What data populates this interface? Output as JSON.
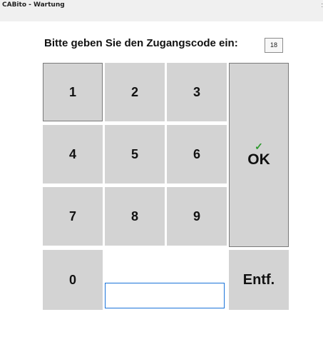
{
  "window": {
    "title": "CABito - Wartung",
    "corner_mark": ":"
  },
  "prompt": {
    "text": "Bitte geben Sie den Zugangscode ein:"
  },
  "digit_count": "18",
  "keypad": {
    "digits": [
      "1",
      "2",
      "3",
      "4",
      "5",
      "6",
      "7",
      "8",
      "9",
      "0"
    ],
    "ok_label": "OK",
    "ok_icon": "check-icon",
    "delete_label": "Entf."
  },
  "code_input": {
    "value": ""
  },
  "colors": {
    "key_bg": "#d3d3d3",
    "input_border": "#1a73d9",
    "check": "#2e9a2e"
  }
}
